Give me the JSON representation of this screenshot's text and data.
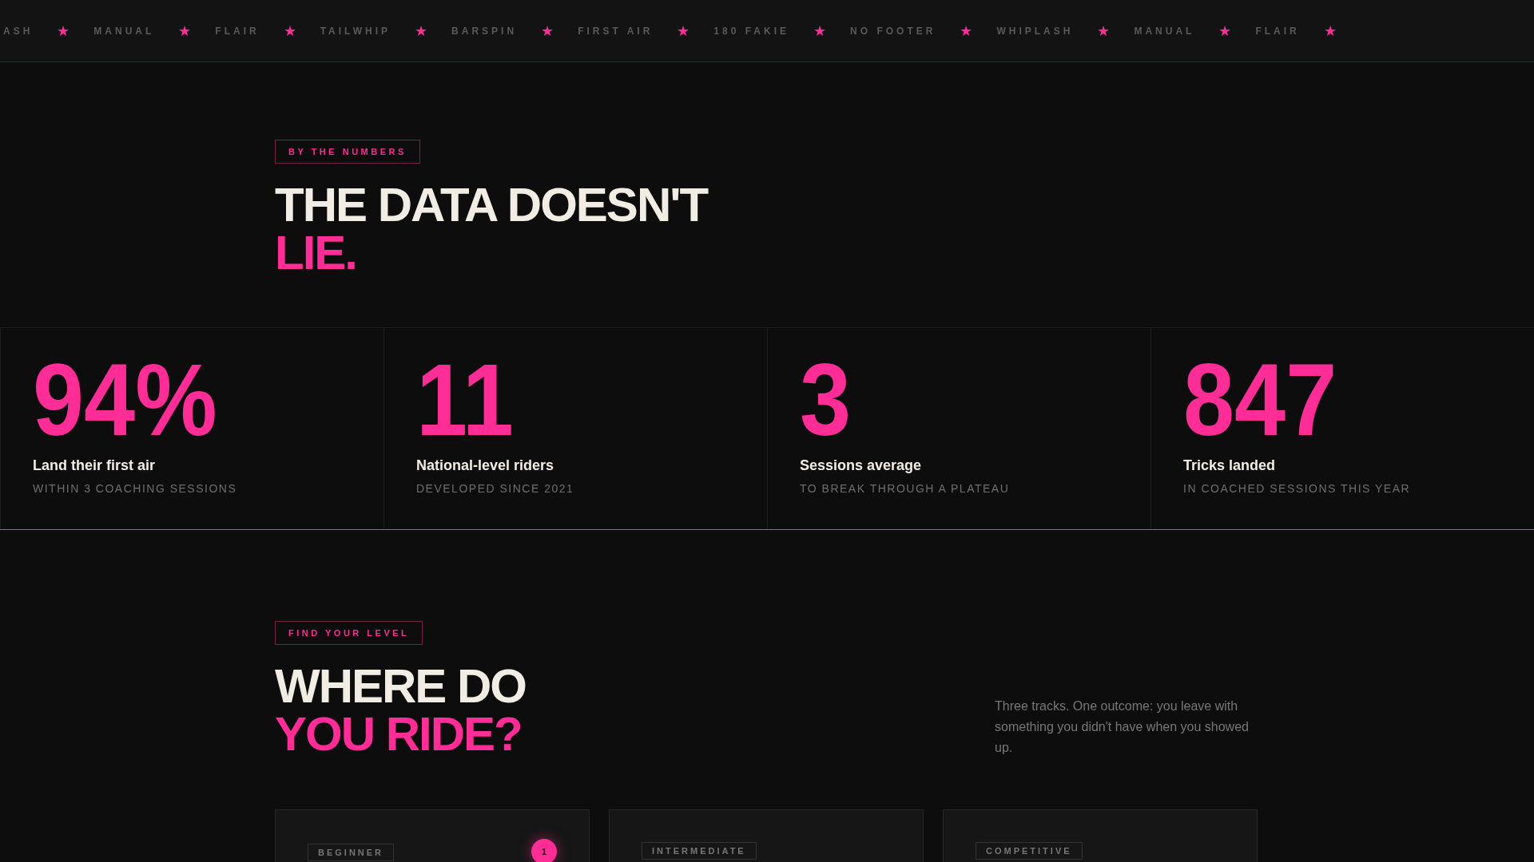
{
  "ticker": [
    {
      "label": "ASH",
      "star": "★"
    },
    {
      "label": "MANUAL",
      "star": "★"
    },
    {
      "label": "FLAIR",
      "star": "★"
    },
    {
      "label": "TAILWHIP",
      "star": "★"
    },
    {
      "label": "BARSPIN",
      "star": "★"
    },
    {
      "label": "FIRST AIR",
      "star": "★"
    },
    {
      "label": "180 FAKIE",
      "star": "★"
    },
    {
      "label": "NO FOOTER",
      "star": "★"
    },
    {
      "label": "WHIPLASH",
      "star": "★"
    },
    {
      "label": "MANUAL",
      "star": "★"
    },
    {
      "label": "FLAIR",
      "star": "★"
    }
  ],
  "numbers_section": {
    "tag": "BY THE NUMBERS",
    "heading": "THE DATA DOESN'T",
    "heading_accent": "LIE."
  },
  "stats": [
    {
      "value": "94%",
      "label": "Land their first air",
      "sub": "WITHIN 3 COACHING SESSIONS"
    },
    {
      "value": "11",
      "label": "National-level riders",
      "sub": "DEVELOPED SINCE 2021"
    },
    {
      "value": "3",
      "label": "Sessions average",
      "sub": "TO BREAK THROUGH A PLATEAU"
    },
    {
      "value": "847",
      "label": "Tricks landed",
      "sub": "IN COACHED SESSIONS THIS YEAR"
    }
  ],
  "level_section": {
    "tag": "FIND YOUR LEVEL",
    "heading": "WHERE DO",
    "heading_accent": "YOU RIDE?",
    "description": "Three tracks. One outcome: you leave with something you didn't have when you showed up."
  },
  "tracks": [
    {
      "tag": "BEGINNER",
      "badge": "1"
    },
    {
      "tag": "INTERMEDIATE"
    },
    {
      "tag": "COMPETITIVE"
    }
  ]
}
